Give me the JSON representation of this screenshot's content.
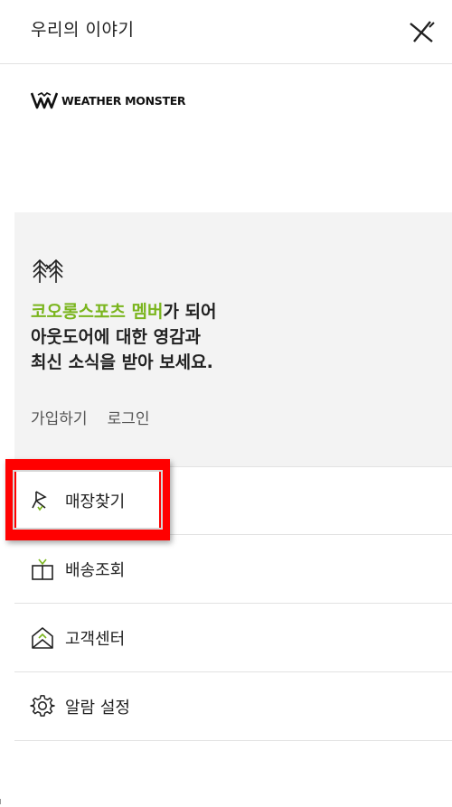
{
  "header": {
    "title": "우리의 이야기"
  },
  "brand": {
    "logo_text": "WEATHER MONSTER"
  },
  "promo": {
    "line1_accent": "코오롱스포츠 멤버",
    "line1_rest": "가 되어",
    "line2": "아웃도어에 대한 영감과",
    "line3": "최신 소식을 받아 보세요.",
    "links": {
      "join": "가입하기",
      "login": "로그인"
    }
  },
  "menu": {
    "items": [
      {
        "label": "매장찾기",
        "icon": "store-locator-icon"
      },
      {
        "label": "배송조회",
        "icon": "delivery-box-icon"
      },
      {
        "label": "고객센터",
        "icon": "customer-center-icon"
      },
      {
        "label": "알람 설정",
        "icon": "gear-icon"
      }
    ]
  },
  "colors": {
    "accent": "#7ab51d",
    "highlight": "#ff0000"
  }
}
